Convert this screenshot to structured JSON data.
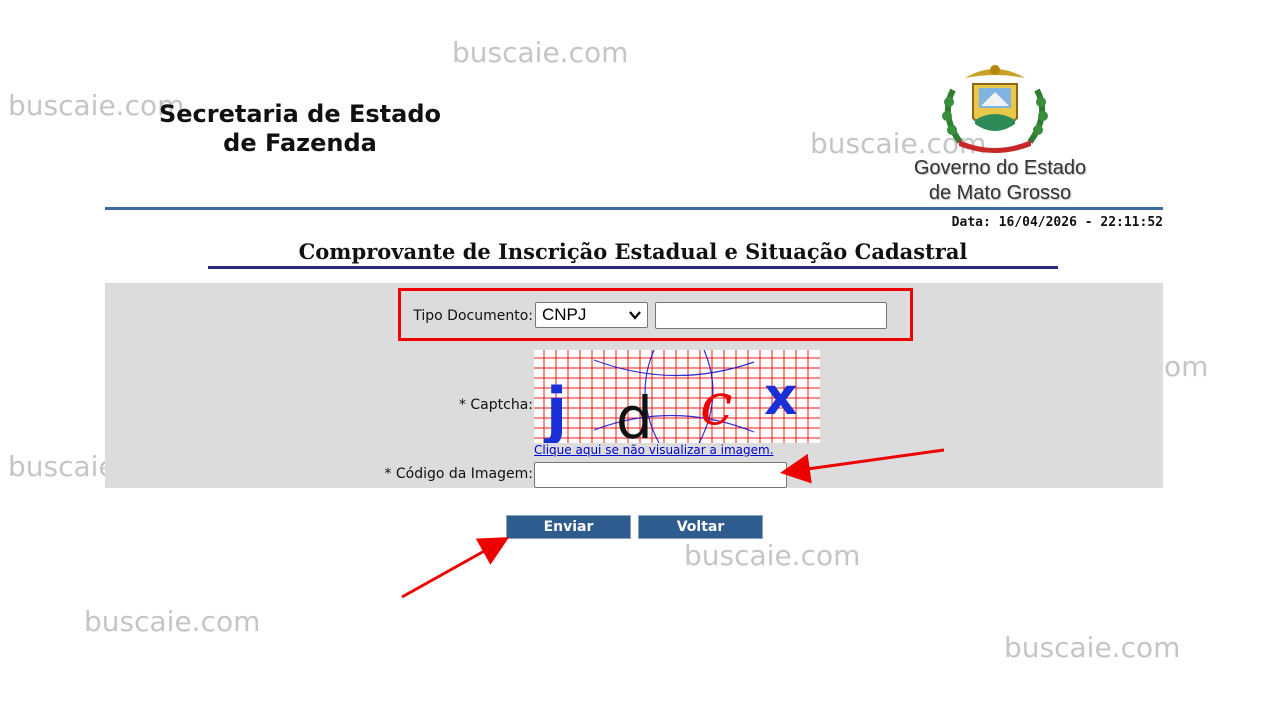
{
  "header": {
    "secretaria_line1": "Secretaria de Estado",
    "secretaria_line2": "de Fazenda",
    "governo_line1": "Governo do Estado",
    "governo_line2": "de Mato Grosso",
    "date": "Data: 16/04/2026 - 22:11:52"
  },
  "page_title": "Comprovante de Inscrição Estadual e Situação Cadastral",
  "form": {
    "tipo_documento_label": "Tipo Documento:",
    "tipo_documento_value": "CNPJ",
    "documento_value": "",
    "captcha_label": "* Captcha:",
    "captcha_text": [
      "j",
      "d",
      "c",
      "x"
    ],
    "captcha_link": "Clique aqui se não visualizar a imagem.",
    "codigo_label": "* Código da Imagem:",
    "codigo_value": ""
  },
  "buttons": {
    "enviar": "Enviar",
    "voltar": "Voltar"
  },
  "watermark": "buscaie.com",
  "colors": {
    "button_bg": "#2f5c8f",
    "panel_bg": "#dcdcdc",
    "highlight": "#e00000",
    "link": "#0000cc"
  }
}
